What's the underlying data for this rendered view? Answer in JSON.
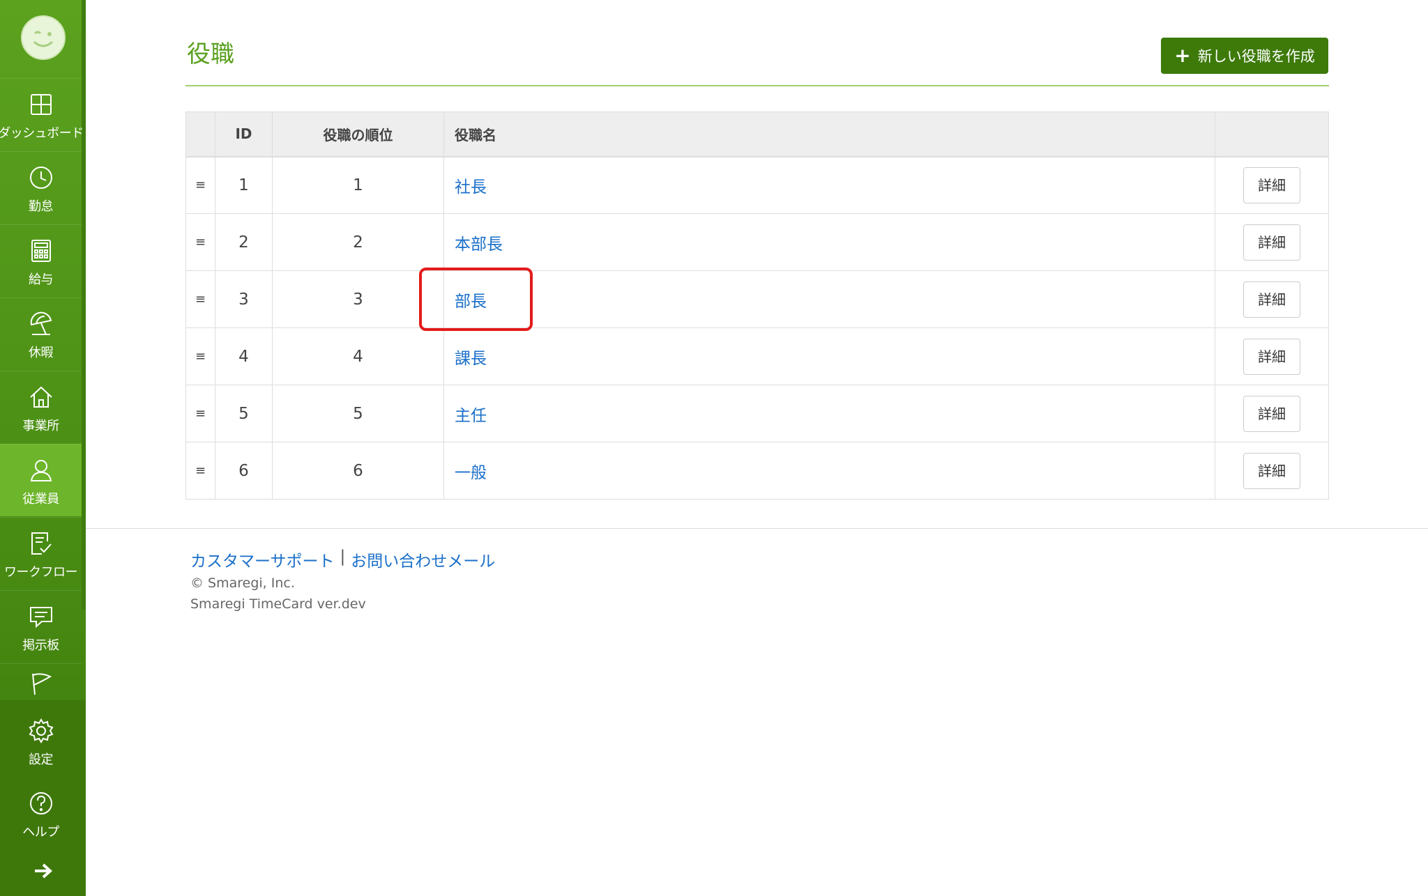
{
  "sidebar": {
    "items": [
      {
        "label": "ダッシュボード",
        "icon": "dashboard-icon"
      },
      {
        "label": "勤怠",
        "icon": "clock-icon"
      },
      {
        "label": "給与",
        "icon": "calculator-icon"
      },
      {
        "label": "休暇",
        "icon": "umbrella-icon"
      },
      {
        "label": "事業所",
        "icon": "home-icon"
      },
      {
        "label": "従業員",
        "icon": "user-icon"
      },
      {
        "label": "ワークフロー",
        "icon": "checklist-icon"
      },
      {
        "label": "掲示板",
        "icon": "message-icon"
      },
      {
        "label": "",
        "icon": "flag-icon"
      },
      {
        "label": "設定",
        "icon": "gear-icon"
      },
      {
        "label": "ヘルプ",
        "icon": "help-icon"
      }
    ],
    "active": "従業員"
  },
  "header": {
    "title": "役職",
    "create_button": "新しい役職を作成"
  },
  "table": {
    "headers": [
      "",
      "ID",
      "役職の順位",
      "役職名",
      ""
    ],
    "rows": [
      {
        "id": "1",
        "rank": "1",
        "name": "社長",
        "action": "詳細"
      },
      {
        "id": "2",
        "rank": "2",
        "name": "本部長",
        "action": "詳細"
      },
      {
        "id": "3",
        "rank": "3",
        "name": "部長",
        "action": "詳細"
      },
      {
        "id": "4",
        "rank": "4",
        "name": "課長",
        "action": "詳細"
      },
      {
        "id": "5",
        "rank": "5",
        "name": "主任",
        "action": "詳細"
      },
      {
        "id": "6",
        "rank": "6",
        "name": "一般",
        "action": "詳細"
      }
    ],
    "handle_glyph": "≡"
  },
  "footer": {
    "support_link": "カスタマーサポート",
    "separator": "|",
    "mail_link": "お問い合わせメール",
    "copyright": "© Smaregi, Inc.",
    "version": "Smaregi TimeCard ver.dev"
  },
  "colors": {
    "sidebar": "#4a8e14",
    "accent": "#5aa020",
    "button": "#3d7a0a",
    "link": "#1a6fc9",
    "highlight": "#e41b1b"
  }
}
